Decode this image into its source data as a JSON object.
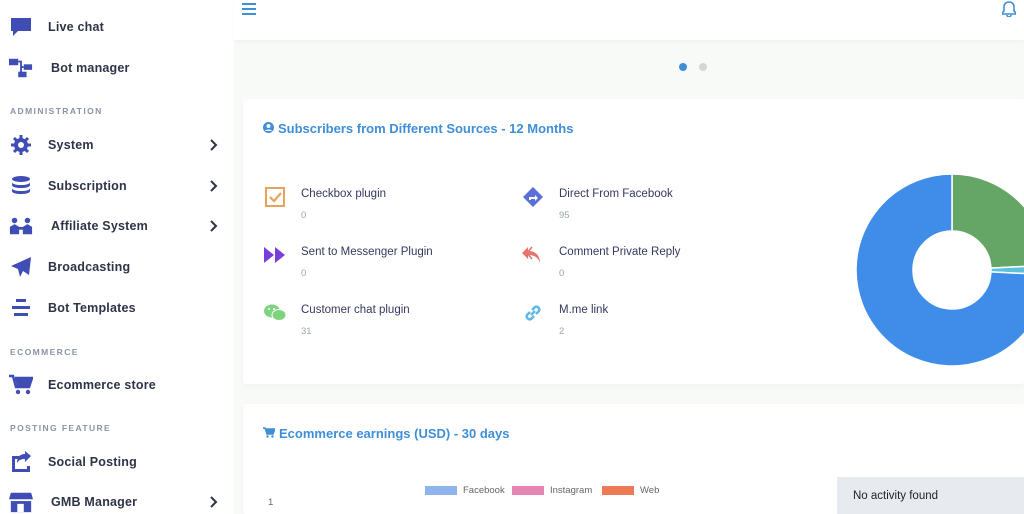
{
  "sidebar": {
    "items": {
      "live_chat": {
        "label": "Live chat",
        "icon": "chat-icon"
      },
      "bot_manager": {
        "label": "Bot manager",
        "icon": "bot-manager-icon"
      },
      "system": {
        "label": "System",
        "icon": "gear-icon"
      },
      "subscription": {
        "label": "Subscription",
        "icon": "coins-icon"
      },
      "affiliate": {
        "label": "Affiliate System",
        "icon": "people-icon"
      },
      "broadcasting": {
        "label": "Broadcasting",
        "icon": "paper-plane-icon"
      },
      "bot_templates": {
        "label": "Bot Templates",
        "icon": "template-icon"
      },
      "ecommerce_store": {
        "label": "Ecommerce store",
        "icon": "cart-icon"
      },
      "social_posting": {
        "label": "Social Posting",
        "icon": "share-icon"
      },
      "gmb_manager": {
        "label": "GMB Manager",
        "icon": "store-icon"
      }
    },
    "sections": {
      "administration": "ADMINISTRATION",
      "ecommerce": "ECOMMERCE",
      "posting": "POSTING FEATURE"
    },
    "accent_color": "#3f4db5"
  },
  "topbar": {
    "menu_icon": "hamburger-icon",
    "bell_icon": "bell-icon",
    "accent_color": "#3f8ed8"
  },
  "carousel": {
    "active_index": 0,
    "count": 2
  },
  "subscribers_card": {
    "title": "Subscribers from Different Sources - 12 Months",
    "title_icon": "user-circle-icon",
    "sources": [
      {
        "label": "Checkbox plugin",
        "value": "0",
        "icon": "checkbox-icon",
        "color": "#e6a35a"
      },
      {
        "label": "Direct From Facebook",
        "value": "95",
        "icon": "direction-icon",
        "color": "#5a6fd8"
      },
      {
        "label": "Sent to Messenger Plugin",
        "value": "0",
        "icon": "forward-icon",
        "color": "#7a3fd8"
      },
      {
        "label": "Comment Private Reply",
        "value": "0",
        "icon": "reply-all-icon",
        "color": "#e8736e"
      },
      {
        "label": "Customer chat plugin",
        "value": "31",
        "icon": "wechat-icon",
        "color": "#7ed37e"
      },
      {
        "label": "M.me link",
        "value": "2",
        "icon": "link-icon",
        "color": "#5bb8e8"
      }
    ],
    "donut": {
      "slices": [
        {
          "name": "Direct From Facebook",
          "value": 95,
          "color": "#3f8de8"
        },
        {
          "name": "Customer chat plugin",
          "value": 31,
          "color": "#65a565"
        },
        {
          "name": "M.me link",
          "value": 2,
          "color": "#5bc0de"
        }
      ]
    }
  },
  "earnings_card": {
    "title": "Ecommerce earnings (USD) - 30 days",
    "title_icon": "cart-icon",
    "legend": [
      {
        "label": "Facebook",
        "color": "#8fb4ec"
      },
      {
        "label": "Instagram",
        "color": "#e685b5"
      },
      {
        "label": "Web",
        "color": "#ee7a55"
      }
    ],
    "y_tick": "1"
  },
  "toast": {
    "message": "No activity found"
  }
}
